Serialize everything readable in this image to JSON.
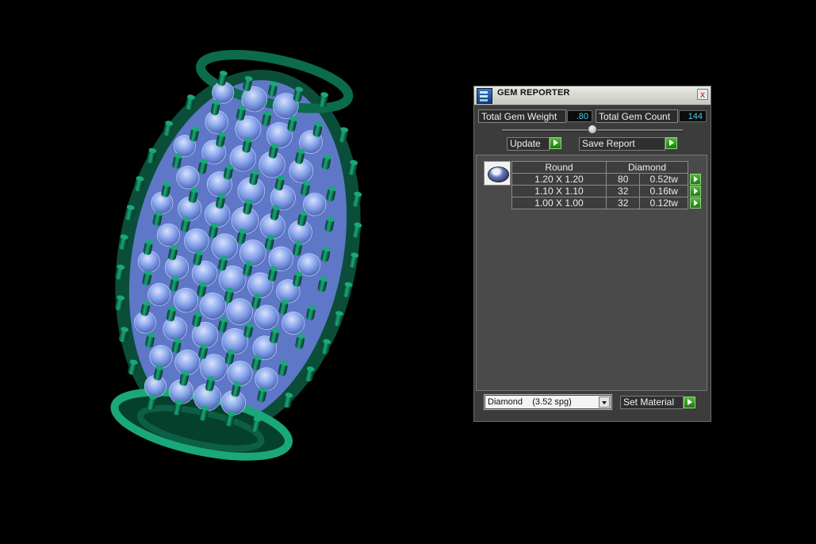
{
  "viewport": {
    "model_colors": {
      "metal": "#0b6b4c",
      "metal_highlight": "#1aa77a",
      "gem": "#8aa7ee",
      "gem_highlight": "#dfe8ff"
    }
  },
  "panel": {
    "title": "GEM REPORTER",
    "close_glyph": "x",
    "total_weight_label": "Total Gem Weight",
    "total_weight_value": ".80",
    "total_count_label": "Total Gem Count",
    "total_count_value": "144",
    "update_label": "Update",
    "save_report_label": "Save Report",
    "table": {
      "headers": [
        "Round",
        "Diamond"
      ],
      "rows": [
        {
          "size": "1.20 X 1.20",
          "count": "80",
          "weight": "0.52tw"
        },
        {
          "size": "1.10 X 1.10",
          "count": "32",
          "weight": "0.16tw"
        },
        {
          "size": "1.00 X 1.00",
          "count": "32",
          "weight": "0.12tw"
        }
      ]
    },
    "material_select": {
      "value": "Diamond    (3.52 spg)"
    },
    "set_material_label": "Set Material"
  }
}
